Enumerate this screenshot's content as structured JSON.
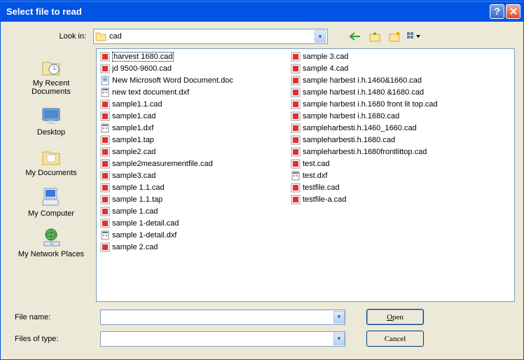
{
  "title": "Select file to read",
  "look_in_label": "Look in:",
  "look_in_value": "cad",
  "places": [
    {
      "label": "My Recent Documents",
      "icon": "recent"
    },
    {
      "label": "Desktop",
      "icon": "desktop"
    },
    {
      "label": "My Documents",
      "icon": "mydocs"
    },
    {
      "label": "My Computer",
      "icon": "computer"
    },
    {
      "label": "My Network Places",
      "icon": "network"
    }
  ],
  "files_col1": [
    {
      "name": "harvest 1680.cad",
      "type": "cad",
      "selected": true
    },
    {
      "name": "jd 9500-9600.cad",
      "type": "cad"
    },
    {
      "name": "New Microsoft Word Document.doc",
      "type": "doc"
    },
    {
      "name": "new text document.dxf",
      "type": "dxf"
    },
    {
      "name": "sample1.1.cad",
      "type": "cad"
    },
    {
      "name": "sample1.cad",
      "type": "cad"
    },
    {
      "name": "sample1.dxf",
      "type": "dxf"
    },
    {
      "name": "sample1.tap",
      "type": "cad"
    },
    {
      "name": "sample2.cad",
      "type": "cad"
    },
    {
      "name": "sample2measurementfile.cad",
      "type": "cad"
    },
    {
      "name": "sample3.cad",
      "type": "cad"
    },
    {
      "name": "sample 1.1.cad",
      "type": "cad"
    },
    {
      "name": "sample 1.1.tap",
      "type": "cad"
    },
    {
      "name": "sample 1.cad",
      "type": "cad"
    },
    {
      "name": "sample 1-detail.cad",
      "type": "cad"
    },
    {
      "name": "sample 1-detail.dxf",
      "type": "dxf"
    },
    {
      "name": "sample 2.cad",
      "type": "cad"
    }
  ],
  "files_col2": [
    {
      "name": "sample 3.cad",
      "type": "cad"
    },
    {
      "name": "sample 4.cad",
      "type": "cad"
    },
    {
      "name": "sample harbest i.h.1460&1660.cad",
      "type": "cad"
    },
    {
      "name": "sample harbest i.h.1480 &1680.cad",
      "type": "cad"
    },
    {
      "name": "sample harbest i.h.1680 front lit top.cad",
      "type": "cad"
    },
    {
      "name": "sample harbest i.h.1680.cad",
      "type": "cad"
    },
    {
      "name": "sampleharbesti.h.1460_1660.cad",
      "type": "cad"
    },
    {
      "name": "sampleharbesti.h.1680.cad",
      "type": "cad"
    },
    {
      "name": "sampleharbesti.h.1680frontlittop.cad",
      "type": "cad"
    },
    {
      "name": "test.cad",
      "type": "cad"
    },
    {
      "name": "test.dxf",
      "type": "dxf"
    },
    {
      "name": "testfile.cad",
      "type": "cad"
    },
    {
      "name": "testfile-a.cad",
      "type": "cad"
    }
  ],
  "file_name_label": "File name:",
  "file_name_value": "",
  "files_of_type_label": "Files of type:",
  "files_of_type_value": "",
  "open_label": "Open",
  "cancel_label": "Cancel"
}
